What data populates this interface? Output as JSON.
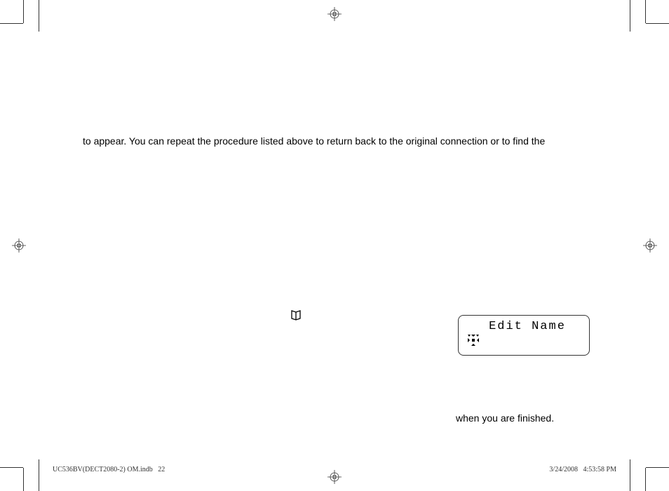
{
  "body_text": "to appear. You can repeat the procedure listed above to return back to the original connection or to find the",
  "display_box": {
    "title": "Edit Name"
  },
  "lower_text": "when you are finished.",
  "footer": {
    "left_filename": "UC536BV(DECT2080-2) OM.indb",
    "left_page": "22",
    "right_date": "3/24/2008",
    "right_time": "4:53:58 PM"
  }
}
